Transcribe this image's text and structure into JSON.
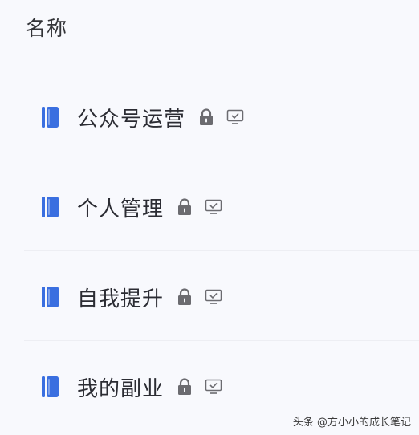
{
  "header": {
    "title": "名称"
  },
  "notebooks": [
    {
      "name": "公众号运营",
      "book_icon": "notebook-icon",
      "lock_icon": "lock-icon",
      "screen_icon": "monitor-check-icon"
    },
    {
      "name": "个人管理",
      "book_icon": "notebook-icon",
      "lock_icon": "lock-icon",
      "screen_icon": "monitor-check-icon"
    },
    {
      "name": "自我提升",
      "book_icon": "notebook-icon",
      "lock_icon": "lock-icon",
      "screen_icon": "monitor-check-icon"
    },
    {
      "name": "我的副业",
      "book_icon": "notebook-icon",
      "lock_icon": "lock-icon",
      "screen_icon": "monitor-check-icon"
    }
  ],
  "watermark": {
    "text": "头条 @方小小的成长笔记"
  },
  "colors": {
    "book_blue": "#3a6fe0",
    "icon_gray": "#6b6b70",
    "text": "#2b2c33",
    "background": "#f8f9fd"
  }
}
